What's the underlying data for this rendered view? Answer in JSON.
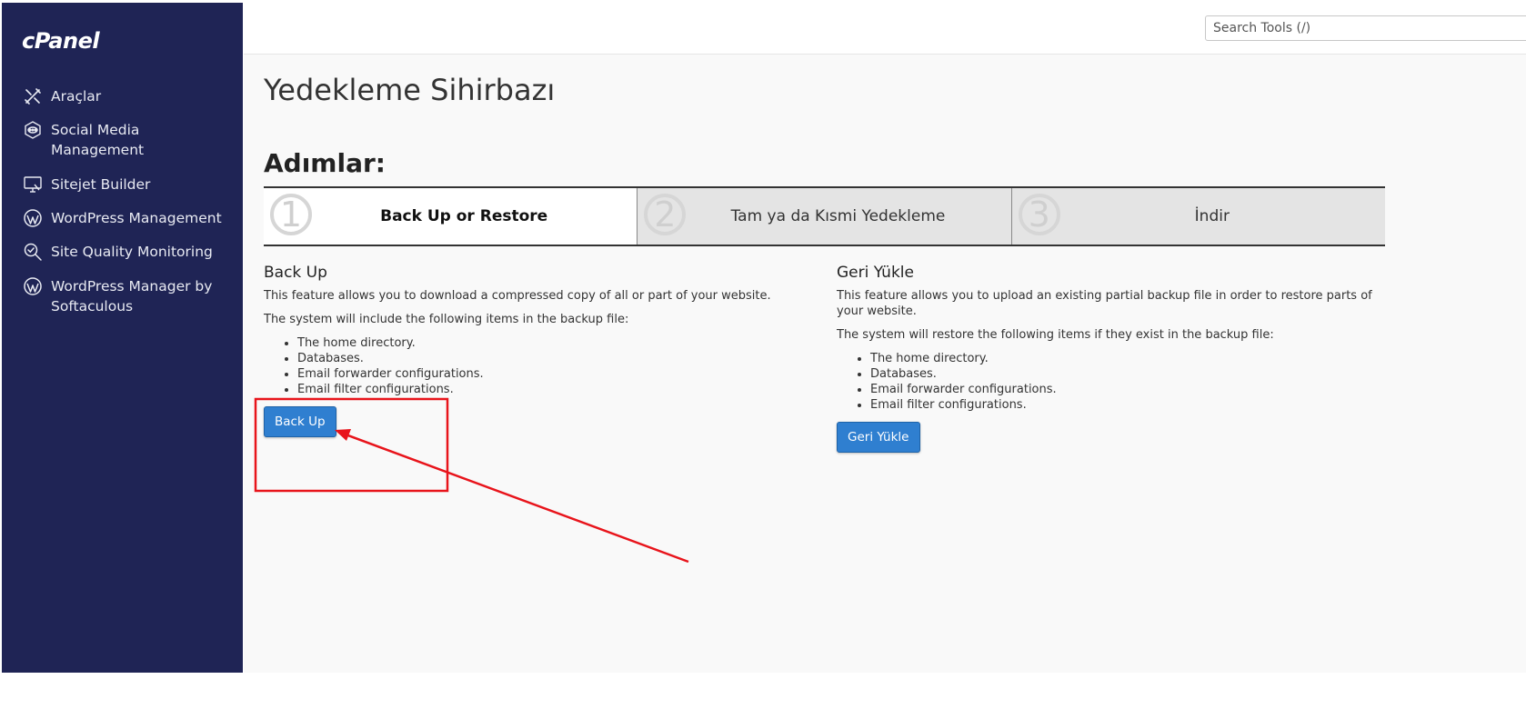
{
  "app": {
    "logo": "cPanel"
  },
  "sidebar": {
    "items": [
      {
        "label": "Araçlar",
        "icon": "tools-icon"
      },
      {
        "label": "Social Media Management",
        "icon": "social-media-icon"
      },
      {
        "label": "Sitejet Builder",
        "icon": "monitor-icon"
      },
      {
        "label": "WordPress Management",
        "icon": "wordpress-icon"
      },
      {
        "label": "Site Quality Monitoring",
        "icon": "magnifier-check-icon"
      },
      {
        "label": "WordPress Manager by Softaculous",
        "icon": "wordpress-icon"
      }
    ]
  },
  "search": {
    "placeholder": "Search Tools (/)"
  },
  "page": {
    "title": "Yedekleme Sihirbazı",
    "steps_heading": "Adımlar:"
  },
  "steps": [
    {
      "number": "1",
      "label": "Back Up or Restore",
      "active": true
    },
    {
      "number": "2",
      "label": "Tam ya da Kısmi Yedekleme",
      "active": false
    },
    {
      "number": "3",
      "label": "İndir",
      "active": false
    }
  ],
  "backup": {
    "heading": "Back Up",
    "desc": "This feature allows you to download a compressed copy of all or part of your website.",
    "list_intro": "The system will include the following items in the backup file:",
    "items": [
      "The home directory.",
      "Databases.",
      "Email forwarder configurations.",
      "Email filter configurations."
    ],
    "button": "Back Up"
  },
  "restore": {
    "heading": "Geri Yükle",
    "desc": "This feature allows you to upload an existing partial backup file in order to restore parts of your website.",
    "list_intro": "The system will restore the following items if they exist in the backup file:",
    "items": [
      "The home directory.",
      "Databases.",
      "Email forwarder configurations.",
      "Email filter configurations."
    ],
    "button": "Geri Yükle"
  },
  "colors": {
    "sidebar_bg": "#1f2455",
    "button_blue": "#2f7fd0",
    "annotation_red": "#e8141b"
  }
}
